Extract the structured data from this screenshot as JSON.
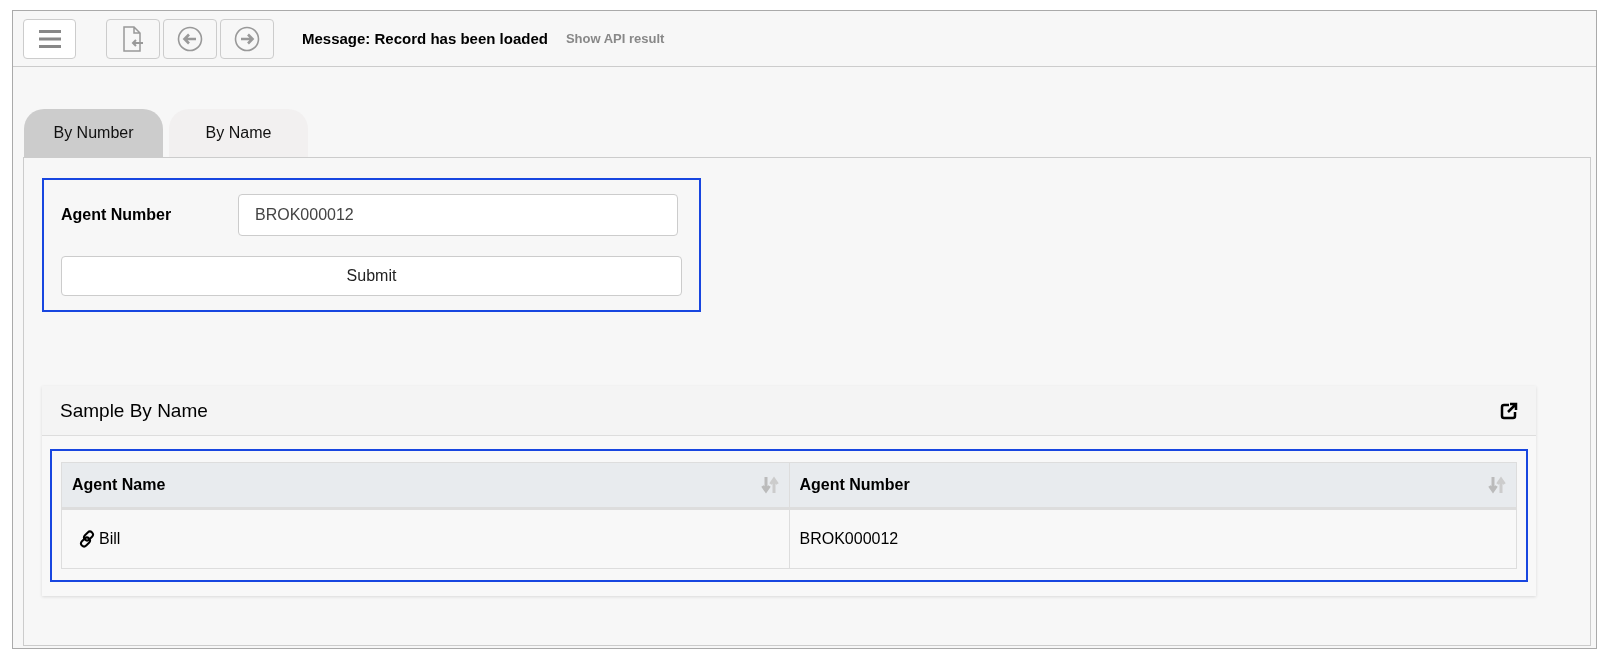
{
  "toolbar": {
    "message": "Message: Record has been loaded",
    "api_link": "Show API result"
  },
  "tabs": [
    {
      "label": "By Number",
      "selected": true
    },
    {
      "label": "By Name",
      "selected": false
    }
  ],
  "form": {
    "label": "Agent Number",
    "value": "BROK000012",
    "submit": "Submit"
  },
  "card": {
    "title": "Sample By Name",
    "table": {
      "columns": [
        "Agent Name",
        "Agent Number"
      ],
      "rows": [
        {
          "name": "Bill",
          "number": "BROK000012"
        }
      ]
    }
  }
}
